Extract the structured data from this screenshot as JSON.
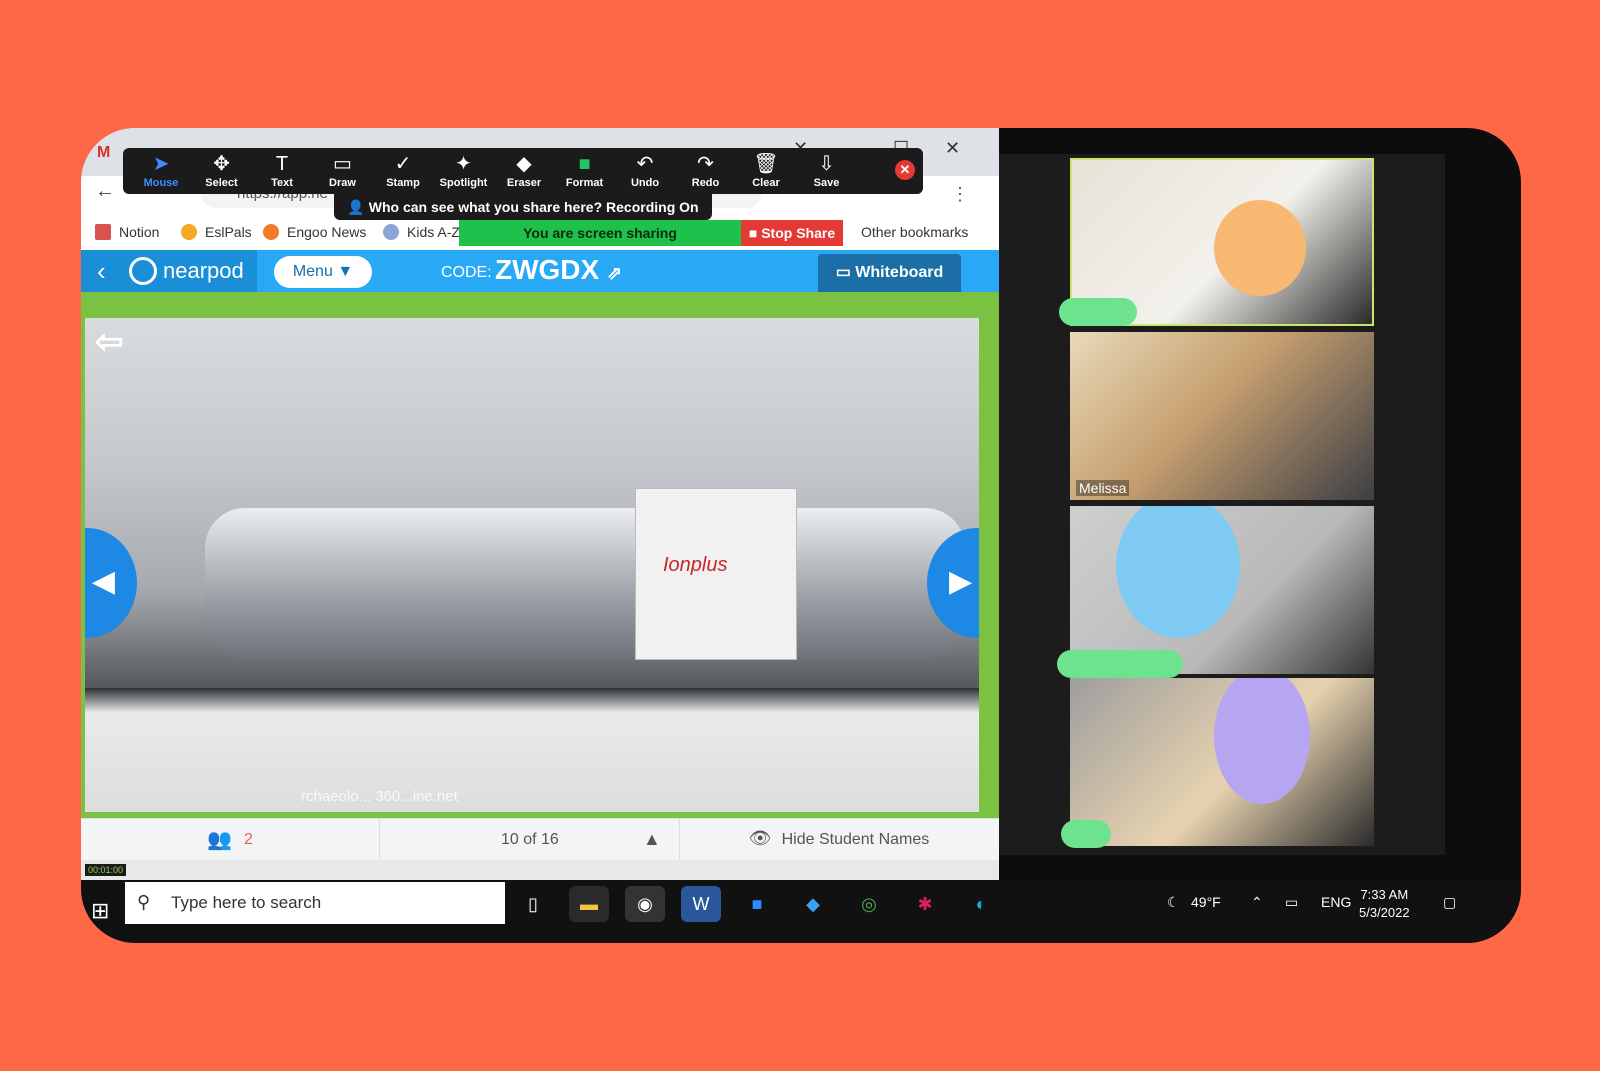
{
  "colors": {
    "background": "#ff6847",
    "nearpod_blue": "#29a8f5",
    "slide_border": "#7cc242",
    "share_green": "#1ec14b",
    "stop_red": "#e53935",
    "zoom_accent": "#3f8cff"
  },
  "annotate_tools": [
    {
      "icon": "cursor-arrow-icon",
      "glyph": "➤",
      "label": "Mouse",
      "active": true
    },
    {
      "icon": "move-arrows-icon",
      "glyph": "✥",
      "label": "Select"
    },
    {
      "icon": "text-icon",
      "glyph": "T",
      "label": "Text"
    },
    {
      "icon": "rectangle-icon",
      "glyph": "▭",
      "label": "Draw"
    },
    {
      "icon": "check-mark-icon",
      "glyph": "✓",
      "label": "Stamp"
    },
    {
      "icon": "magic-wand-icon",
      "glyph": "✦",
      "label": "Spotlight"
    },
    {
      "icon": "eraser-icon",
      "glyph": "◆",
      "label": "Eraser"
    },
    {
      "icon": "green-square-icon",
      "glyph": "■",
      "label": "Format"
    },
    {
      "icon": "undo-icon",
      "glyph": "↶",
      "label": "Undo"
    },
    {
      "icon": "redo-icon",
      "glyph": "↷",
      "label": "Redo"
    },
    {
      "icon": "trash-icon",
      "glyph": "🗑",
      "label": "Clear"
    },
    {
      "icon": "download-icon",
      "glyph": "⇩",
      "label": "Save"
    }
  ],
  "browser": {
    "url": "https://app.ne",
    "bookmarks": [
      "Notion",
      "EslPals",
      "Engoo News",
      "Kids A-Z"
    ],
    "other_bookmarks": "Other bookmarks"
  },
  "share": {
    "recording_banner": "Who can see what you share here? Recording On",
    "sharing_text": "You are screen sharing",
    "stop_share": "Stop Share"
  },
  "nearpod": {
    "logo": "nearpod",
    "menu": "Menu",
    "code_label": "CODE:",
    "code": "ZWGDX",
    "whiteboard": "Whiteboard",
    "slide_brand": "Ionplus",
    "watermark": "rchaeolo...     360...ine.net",
    "students_count": "2",
    "pager": "10 of 16",
    "hide_names": "Hide Student Names",
    "timer": "00:01:00"
  },
  "gallery": {
    "participant_name": "Melissa"
  },
  "taskbar": {
    "search_placeholder": "Type here to search",
    "temperature": "49°F",
    "language": "ENG",
    "time": "7:33 AM",
    "date": "5/3/2022"
  }
}
